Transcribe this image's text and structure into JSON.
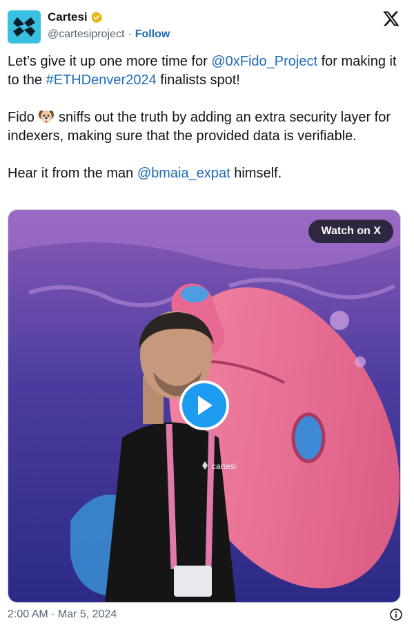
{
  "author": {
    "display_name": "Cartesi",
    "handle": "@cartesiproject",
    "separator": "·",
    "follow_label": "Follow",
    "verified_badge_color": "#e2b719",
    "avatar_color": "#39bfe0"
  },
  "tweet": {
    "p1_before": "Let’s give it up one more time for ",
    "p1_mention": "@0xFido_Project",
    "p1_middle": " for making it to the ",
    "p1_hashtag": "#ETHDenver2024",
    "p1_after": " finalists spot!",
    "p2_before": "Fido ",
    "p2_emoji": "dog-face-emoji",
    "p2_after": " sniffs out the truth by adding an extra security layer for indexers, making sure that the provided data is verifiable.",
    "p3_before": "Hear it from the man ",
    "p3_mention": "@bmaia_expat",
    "p3_after": " himself."
  },
  "media": {
    "watch_label": "Watch on X",
    "shirt_text": "cartesi",
    "play_color": "#1d9bf0"
  },
  "footer": {
    "timestamp": "2:00 AM · Mar 5, 2024"
  },
  "colors": {
    "link": "#1d6ab7",
    "text": "#0f1419",
    "muted": "#536471"
  },
  "icons": [
    "verified-badge-icon",
    "x-logo-icon",
    "play-icon",
    "info-icon",
    "dog-face-emoji"
  ]
}
